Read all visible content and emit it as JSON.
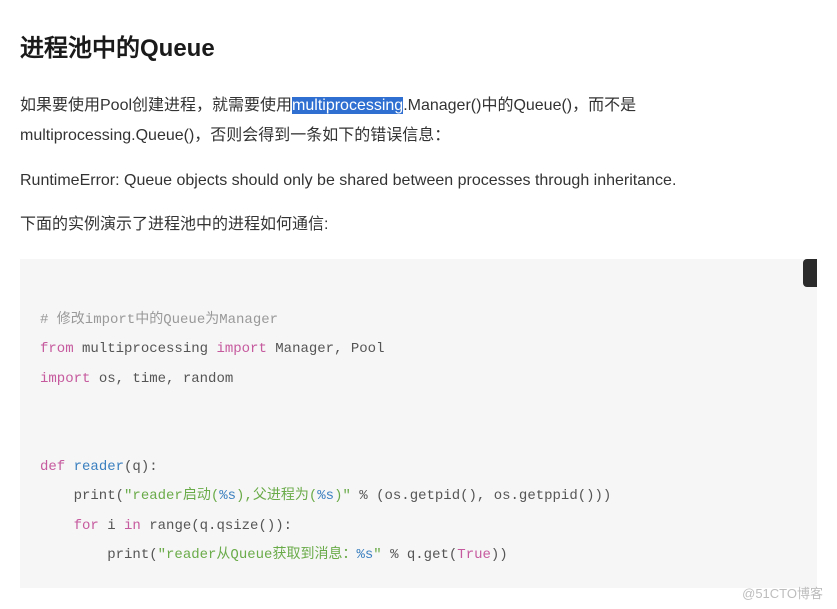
{
  "heading": "进程池中的Queue",
  "paragraphs": {
    "p1a": "如果要使用Pool创建进程，就需要使用",
    "p1_sel": "multiprocessing",
    "p1b": ".Manager()中的Queue()，而不是multiprocessing.Queue()，否则会得到一条如下的错误信息：",
    "p2": "RuntimeError: Queue objects should only be shared between processes through inheritance.",
    "p3": "下面的实例演示了进程池中的进程如何通信:"
  },
  "code": {
    "comment": "# 修改import中的Queue为Manager",
    "l2_from": "from",
    "l2_mod": " multiprocessing ",
    "l2_import": "import",
    "l2_names": " Manager, Pool",
    "l3_import": "import",
    "l3_names": " os, time, random",
    "l4_def": "def ",
    "l4_name": "reader",
    "l4_sig": "(q):",
    "l5_indent": "    print(",
    "l5_str_a": "\"reader启动(",
    "l5_fmt_a": "%s",
    "l5_str_b": "),父进程为(",
    "l5_fmt_b": "%s",
    "l5_str_c": ")\"",
    "l5_tail": " % (os.getpid(), os.getppid()))",
    "l6_for": "    for",
    "l6_mid": " i ",
    "l6_in": "in",
    "l6_rng": " range(q.qsize()):",
    "l7_indent": "        print(",
    "l7_str_a": "\"reader从Queue获取到消息：",
    "l7_fmt": "%s",
    "l7_str_b": "\"",
    "l7_mid": " % q.get(",
    "l7_true": "True",
    "l7_tail": "))"
  },
  "watermark": "@51CTO博客"
}
